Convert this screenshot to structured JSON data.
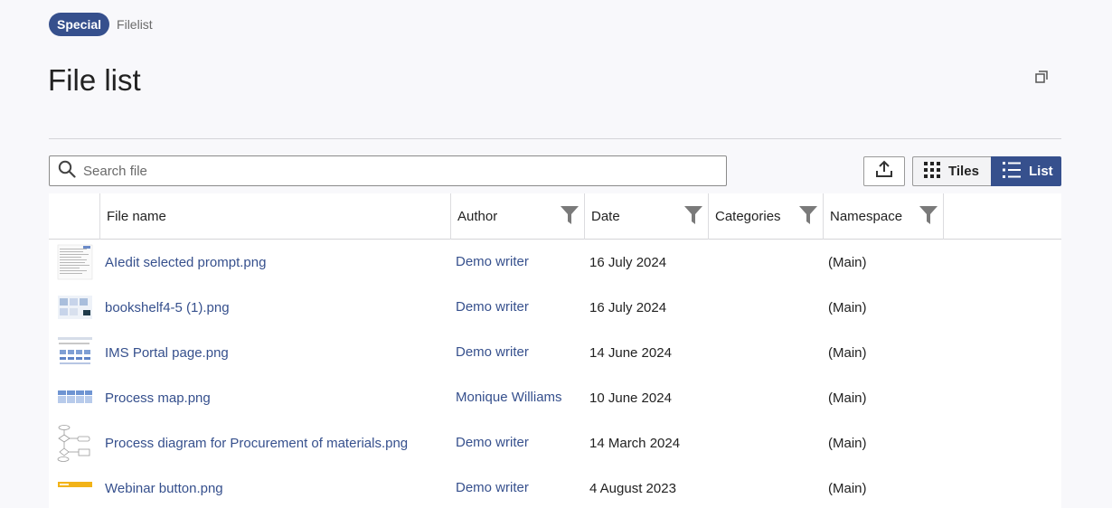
{
  "breadcrumb": {
    "namespace": "Special",
    "page": "Filelist"
  },
  "title": "File list",
  "search": {
    "placeholder": "Search file",
    "value": ""
  },
  "view": {
    "tiles_label": "Tiles",
    "list_label": "List",
    "active": "List"
  },
  "table": {
    "columns": {
      "file_name": "File name",
      "author": "Author",
      "date": "Date",
      "categories": "Categories",
      "namespace": "Namespace"
    },
    "rows": [
      {
        "file_name": "AIedit selected prompt.png",
        "author": "Demo writer",
        "date": "16 July 2024",
        "categories": "",
        "namespace": "(Main)"
      },
      {
        "file_name": "bookshelf4-5 (1).png",
        "author": "Demo writer",
        "date": "16 July 2024",
        "categories": "",
        "namespace": "(Main)"
      },
      {
        "file_name": "IMS Portal page.png",
        "author": "Demo writer",
        "date": "14 June 2024",
        "categories": "",
        "namespace": "(Main)"
      },
      {
        "file_name": "Process map.png",
        "author": "Monique Williams",
        "date": "10 June 2024",
        "categories": "",
        "namespace": "(Main)"
      },
      {
        "file_name": "Process diagram for Procurement of materials.png",
        "author": "Demo writer",
        "date": "14 March 2024",
        "categories": "",
        "namespace": "(Main)"
      },
      {
        "file_name": "Webinar button.png",
        "author": "Demo writer",
        "date": "4 August 2023",
        "categories": "",
        "namespace": "(Main)"
      }
    ]
  },
  "colors": {
    "accent": "#36508d",
    "link": "#36508d",
    "background": "#f8f8fb"
  },
  "icons": [
    "search-icon",
    "upload-icon",
    "grid-icon",
    "list-icon",
    "filter-icon",
    "expand-icon"
  ]
}
